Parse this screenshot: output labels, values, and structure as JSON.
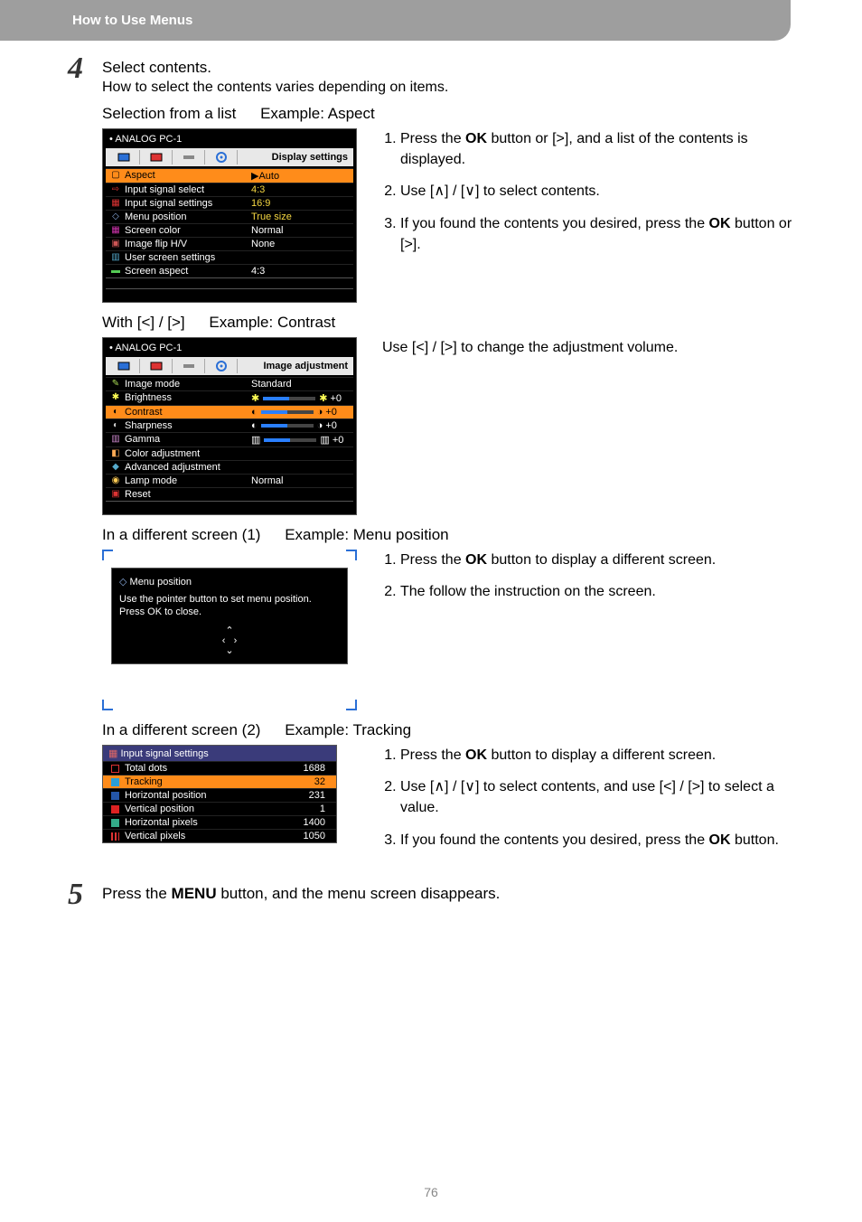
{
  "header": {
    "title": "How to Use Menus"
  },
  "step4": {
    "number": "4",
    "title": "Select contents.",
    "desc": "How to select the contents varies depending on items."
  },
  "section_a": {
    "heading_left": "Selection from a list",
    "heading_right": "Example: Aspect",
    "list": [
      "Press the OK button or [>], and a list of the contents is displayed.",
      "Use [∧] / [∨] to select contents.",
      "If you found the contents you desired, press the OK button or [>]."
    ],
    "osd": {
      "title": "ANALOG PC-1",
      "section": "Display settings",
      "rows": [
        {
          "label": "Aspect",
          "value": "▶Auto",
          "hl": true
        },
        {
          "label": "Input signal select",
          "value": "4:3",
          "yellow": true
        },
        {
          "label": "Input signal settings",
          "value": "16:9",
          "yellow": true
        },
        {
          "label": "Menu position",
          "value": "True size",
          "yellow": true
        },
        {
          "label": "Screen color",
          "value": "Normal"
        },
        {
          "label": "Image flip H/V",
          "value": "None"
        },
        {
          "label": "User screen settings",
          "value": ""
        },
        {
          "label": "Screen aspect",
          "value": "4:3"
        }
      ]
    }
  },
  "section_b": {
    "heading_left": "With [<] / [>]",
    "heading_right": "Example: Contrast",
    "right_text": "Use [<] / [>] to change the adjustment volume.",
    "osd": {
      "title": "ANALOG PC-1",
      "section": "Image adjustment",
      "rows": [
        {
          "label": "Image mode",
          "value": "Standard"
        },
        {
          "label": "Brightness",
          "value": "✱ ───── ✱ +0",
          "slider": true
        },
        {
          "label": "Contrast",
          "value": "◐ ───── ◑ +0",
          "hl": true,
          "slider": true
        },
        {
          "label": "Sharpness",
          "value": "◐ ───── ◑ +0",
          "slider": true
        },
        {
          "label": "Gamma",
          "value": "▥ ───── ▥ +0",
          "slider": true
        },
        {
          "label": "Color adjustment",
          "value": ""
        },
        {
          "label": "Advanced adjustment",
          "value": ""
        },
        {
          "label": "Lamp mode",
          "value": "Normal"
        },
        {
          "label": "Reset",
          "value": ""
        }
      ]
    }
  },
  "section_c": {
    "heading_left": "In a different screen (1)",
    "heading_right": "Example: Menu position",
    "list": [
      "Press the OK button to display a different screen.",
      "The follow the instruction on the screen."
    ],
    "popup": {
      "title": "Menu position",
      "body1": "Use the pointer button to set menu position.",
      "body2": "Press OK to close."
    }
  },
  "section_d": {
    "heading_left": "In a different screen (2)",
    "heading_right": "Example: Tracking",
    "list": [
      "Press the OK button to display a different screen.",
      "Use [∧] / [∨] to select contents, and use [<] / [>] to select a value.",
      "If you found the contents you desired, press the OK button."
    ],
    "osd": {
      "title": "Input signal settings",
      "rows": [
        {
          "label": "Total dots",
          "value": "1688"
        },
        {
          "label": "Tracking",
          "value": "32",
          "hl": true
        },
        {
          "label": "Horizontal position",
          "value": "231"
        },
        {
          "label": "Vertical position",
          "value": "1"
        },
        {
          "label": "Horizontal pixels",
          "value": "1400"
        },
        {
          "label": "Vertical pixels",
          "value": "1050"
        }
      ]
    }
  },
  "step5": {
    "number": "5",
    "text": "Press the MENU button, and the menu screen disappears."
  },
  "page_number": "76"
}
